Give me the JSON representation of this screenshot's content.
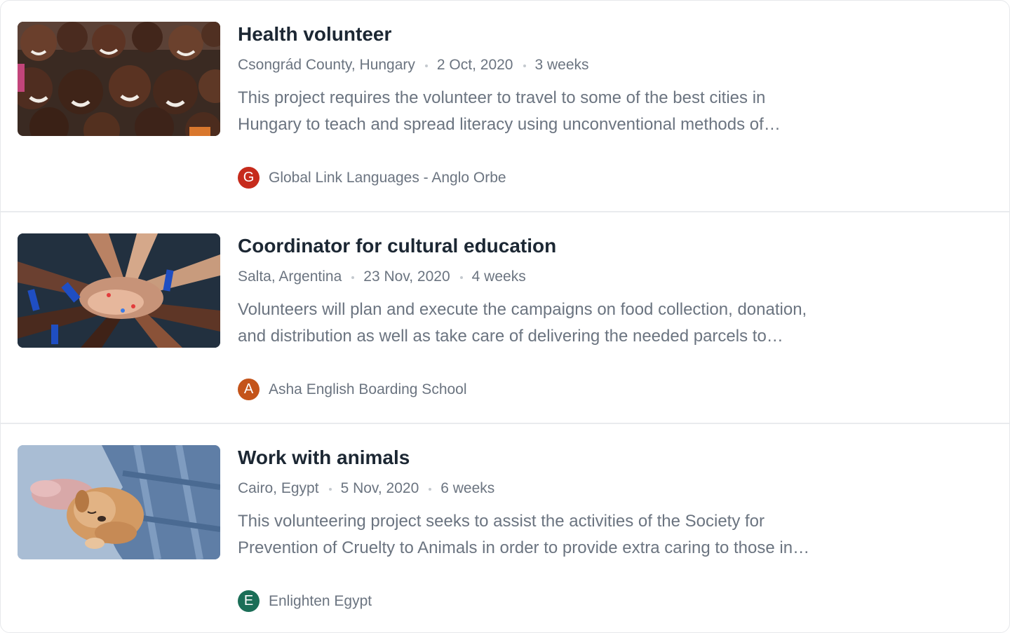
{
  "listings": [
    {
      "title": "Health volunteer",
      "location": "Csongrád County, Hungary",
      "date": "2 Oct, 2020",
      "duration": "3 weeks",
      "description": "This project requires the volunteer to travel to some of the best cities in Hungary to teach and spread literacy using unconventional methods of teaching and playful activities.",
      "org_initial": "G",
      "org_name": "Global Link Languages - Anglo Orbe",
      "org_color": "#c62b1c",
      "image": "group-of-smiling-children-photo"
    },
    {
      "title": "Coordinator for cultural education",
      "location": "Salta, Argentina",
      "date": "23 Nov, 2020",
      "duration": "4 weeks",
      "description": "Volunteers will plan and execute the campaigns on food collection, donation, and distribution as well as take care of delivering the needed parcels to families.",
      "org_initial": "A",
      "org_name": "Asha English Boarding School",
      "org_color": "#c4541a",
      "image": "stacked-hands-photo"
    },
    {
      "title": "Work with animals",
      "location": "Cairo, Egypt",
      "date": "5 Nov, 2020",
      "duration": "6 weeks",
      "description": "This volunteering project seeks to assist the activities of the Society for Prevention of Cruelty to Animals in order to provide extra caring to those in need.",
      "org_initial": "E",
      "org_name": "Enlighten Egypt",
      "org_color": "#1b6e57",
      "image": "puppy-in-arms-photo"
    }
  ]
}
